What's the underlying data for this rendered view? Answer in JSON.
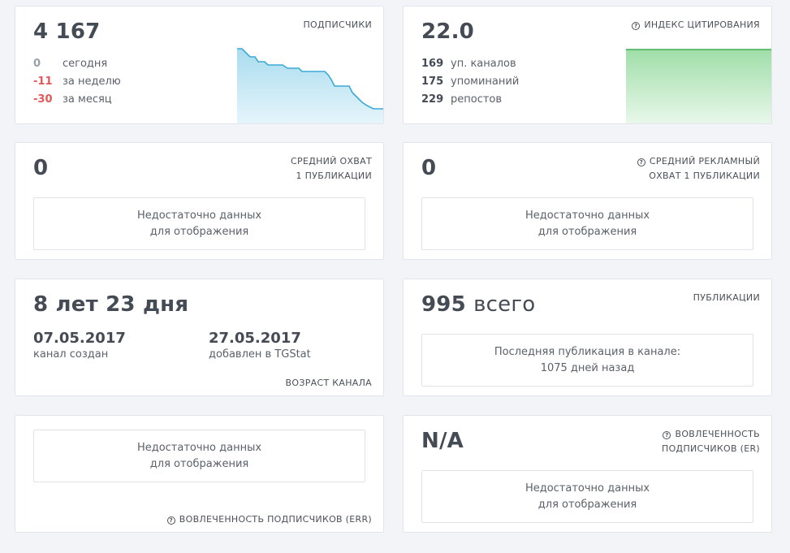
{
  "subscribers": {
    "value": "4 167",
    "caption": "ПОДПИСЧИКИ",
    "rows": [
      {
        "num": "0",
        "label": "сегодня"
      },
      {
        "num": "-11",
        "label": "за неделю"
      },
      {
        "num": "-30",
        "label": "за месяц"
      }
    ],
    "color": "#3aaad6"
  },
  "citation": {
    "value": "22.0",
    "caption": "ИНДЕКС ЦИТИРОВАНИЯ",
    "rows": [
      {
        "num": "169",
        "label": "уп. каналов"
      },
      {
        "num": "175",
        "label": "упоминаний"
      },
      {
        "num": "229",
        "label": "репостов"
      }
    ],
    "color": "#3fae52"
  },
  "avg_reach": {
    "value": "0",
    "caption_line1": "СРЕДНИЙ ОХВАТ",
    "caption_line2": "1 ПУБЛИКАЦИИ",
    "nodata_line1": "Недостаточно данных",
    "nodata_line2": "для отображения"
  },
  "avg_ad_reach": {
    "value": "0",
    "caption_line1": "СРЕДНИЙ РЕКЛАМНЫЙ",
    "caption_line2": "ОХВАТ 1 ПУБЛИКАЦИИ",
    "nodata_line1": "Недостаточно данных",
    "nodata_line2": "для отображения"
  },
  "channel_age": {
    "value": "8 лет 23 дня",
    "created_date": "07.05.2017",
    "created_label": "канал создан",
    "added_date": "27.05.2017",
    "added_label": "добавлен в TGStat",
    "caption": "ВОЗРАСТ КАНАЛА"
  },
  "publications": {
    "value_num": "995",
    "value_suffix": "всего",
    "caption": "ПУБЛИКАЦИИ",
    "last_line1": "Последняя публикация в канале:",
    "last_line2": "1075 дней назад"
  },
  "err": {
    "nodata_line1": "Недостаточно данных",
    "nodata_line2": "для отображения",
    "caption": "ВОВЛЕЧЕННОСТЬ ПОДПИСЧИКОВ (ERR)"
  },
  "er": {
    "value": "N/A",
    "caption_line1": "ВОВЛЕЧЕННОСТЬ",
    "caption_line2": "ПОДПИСЧИКОВ (ER)",
    "nodata_line1": "Недостаточно данных",
    "nodata_line2": "для отображения"
  },
  "icons": {
    "help": "?"
  }
}
